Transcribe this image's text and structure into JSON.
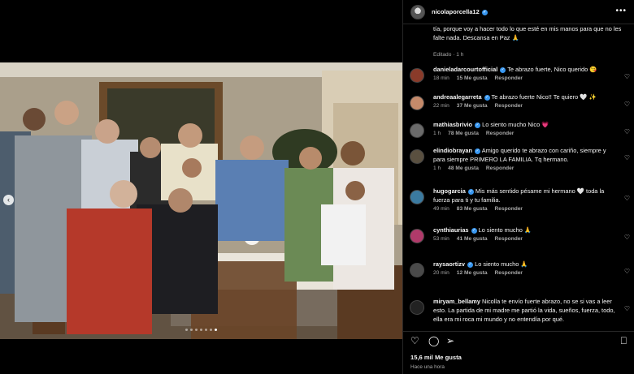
{
  "post": {
    "owner": "nicolaporcella12",
    "caption": "tía, porque voy a hacer todo lo que esté en mis manos para que no les falte nada. Descansa en Paz 🙏",
    "edited": "Editado",
    "time": "1 h",
    "likes": "15,6 mil Me gusta",
    "posted": "Hace una hora"
  },
  "media": {
    "current_slide": 7,
    "total_slides": 7
  },
  "comments": [
    {
      "user": "danieladarcourtofficial",
      "text": "Te abrazo fuerte, Nico querido 😘",
      "time": "18 min",
      "likes": "15 Me gusta",
      "reply": "Responder",
      "avatar_color": "#8a3b2a"
    },
    {
      "user": "andreaalegarreta",
      "text": "Te abrazo fuerte Nico!! Te quiero 🤍 ✨",
      "time": "22 min",
      "likes": "37 Me gusta",
      "reply": "Responder",
      "avatar_color": "#c58a6a"
    },
    {
      "user": "mathiasbrivio",
      "text": "Lo siento mucho Nico 💗",
      "time": "1 h",
      "likes": "78 Me gusta",
      "reply": "Responder",
      "avatar_color": "#6b6b6b"
    },
    {
      "user": "elindiobrayan",
      "text": "Amigo querido te abrazo con cariño, siempre y para siempre PRIMERO LA FAMILIA. Tq hermano.",
      "time": "1 h",
      "likes": "48 Me gusta",
      "reply": "Responder",
      "avatar_color": "#5a5040"
    },
    {
      "user": "hugogarcia",
      "text": "Mis más sentido pésame mi hermano 🤍 toda la fuerza para ti y tu familia.",
      "time": "49 min",
      "likes": "83 Me gusta",
      "reply": "Responder",
      "avatar_color": "#3b7aa0"
    },
    {
      "user": "cynthiaurias",
      "text": "Lo siento mucho 🙏",
      "time": "53 min",
      "likes": "41 Me gusta",
      "reply": "Responder",
      "avatar_color": "#b03a6a"
    },
    {
      "user": "raysaortizv",
      "text": "Lo siento mucho 🙏",
      "time": "20 min",
      "likes": "12 Me gusta",
      "reply": "Responder",
      "avatar_color": "#4a4a4a"
    },
    {
      "user": "miryam_bellamy",
      "text": "Nicolla te envío fuerte abrazo, no se si vas a leer esto. La partida de mi madre me partió la vida, sueños, fuerza, todo, ella era mi roca mi mundo y no entendía por qué.",
      "time": "",
      "likes": "",
      "reply": "",
      "avatar_color": "#222222"
    }
  ],
  "icons": {
    "prev": "chevron-left-icon",
    "more": "more-icon",
    "verified": "verified-badge-icon",
    "like": "heart-icon",
    "comment": "comment-icon",
    "share": "share-icon",
    "save": "bookmark-icon"
  }
}
